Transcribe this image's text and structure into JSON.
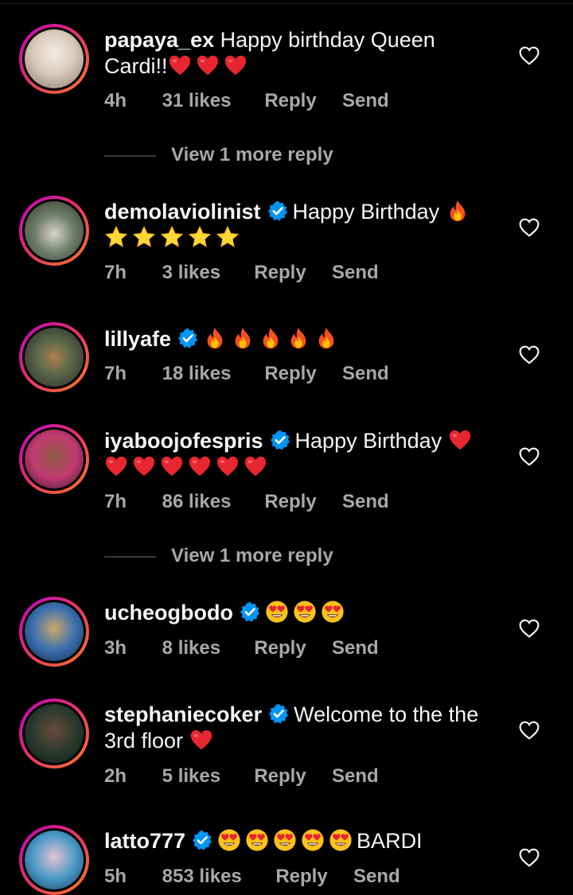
{
  "comments": [
    {
      "username": "papaya_ex",
      "verified": false,
      "text_before": "Happy birthday Queen Cardi!!",
      "emojis": [
        "red-heart",
        "red-heart",
        "red-heart"
      ],
      "time": "4h",
      "likes": "31 likes",
      "reply": "Reply",
      "send": "Send",
      "view_more": "View 1 more reply"
    },
    {
      "username": "demolaviolinist",
      "verified": true,
      "text_before": "Happy Birthday",
      "emojis": [
        "fire",
        "star",
        "star",
        "star",
        "star",
        "star"
      ],
      "time": "7h",
      "likes": "3 likes",
      "reply": "Reply",
      "send": "Send"
    },
    {
      "username": "lillyafe",
      "verified": true,
      "text_before": "",
      "emojis": [
        "fire",
        "fire",
        "fire",
        "fire",
        "fire"
      ],
      "time": "7h",
      "likes": "18 likes",
      "reply": "Reply",
      "send": "Send"
    },
    {
      "username": "iyaboojofespris",
      "verified": true,
      "text_before": "Happy Birthday",
      "emojis": [
        "red-heart",
        "red-heart",
        "red-heart",
        "red-heart",
        "red-heart",
        "red-heart",
        "red-heart"
      ],
      "time": "7h",
      "likes": "86 likes",
      "reply": "Reply",
      "send": "Send",
      "view_more": "View 1 more reply"
    },
    {
      "username": "ucheogbodo",
      "verified": true,
      "text_before": "",
      "emojis": [
        "heart-eyes",
        "heart-eyes",
        "heart-eyes"
      ],
      "time": "3h",
      "likes": "8 likes",
      "reply": "Reply",
      "send": "Send"
    },
    {
      "username": "stephaniecoker",
      "verified": true,
      "text_before": "Welcome to the the 3rd floor",
      "emojis": [
        "red-heart"
      ],
      "time": "2h",
      "likes": "5 likes",
      "reply": "Reply",
      "send": "Send"
    },
    {
      "username": "latto777",
      "verified": true,
      "text_before": "",
      "emojis": [
        "heart-eyes",
        "heart-eyes",
        "heart-eyes",
        "heart-eyes",
        "heart-eyes"
      ],
      "text_after": "BARDI",
      "time": "5h",
      "likes": "853 likes",
      "reply": "Reply",
      "send": "Send"
    }
  ],
  "colors": {
    "background": "#000000",
    "primary_text": "#f5f5f5",
    "secondary_text": "#a8a8a8",
    "verified_blue": "#0095f6",
    "story_ring_start": "#c300c8",
    "story_ring_end": "#fd7a1f"
  }
}
